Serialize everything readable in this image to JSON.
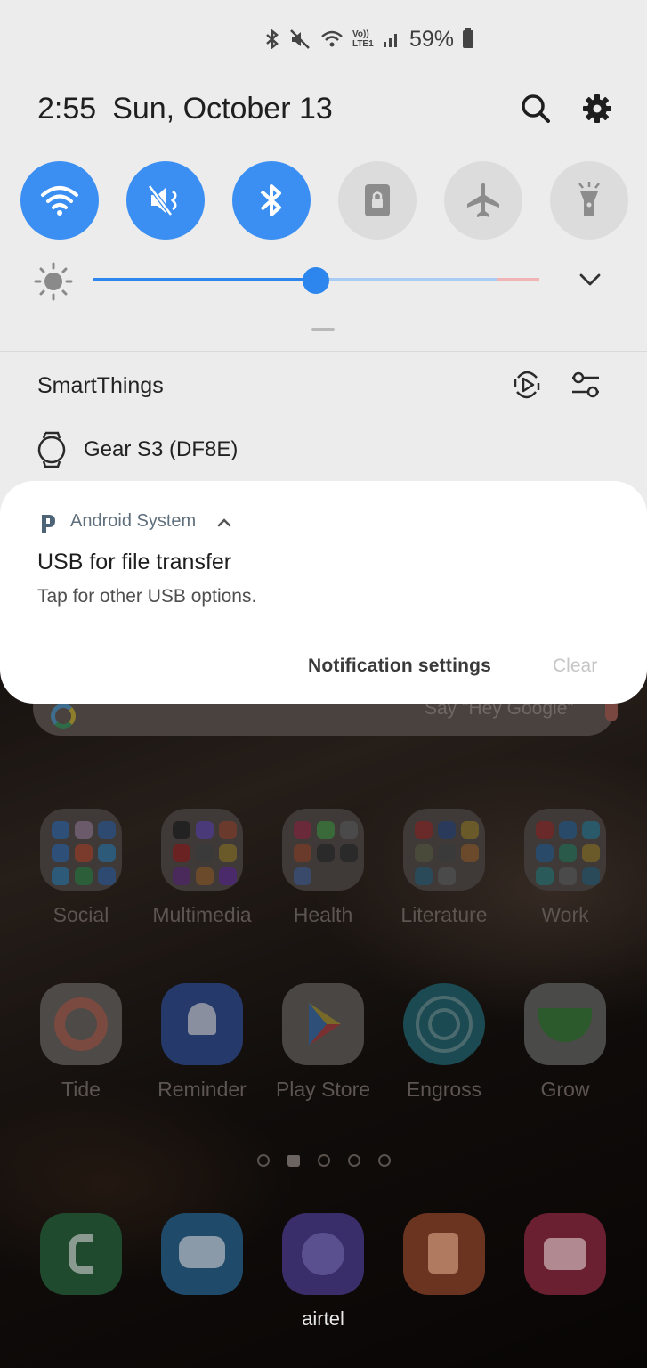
{
  "status_bar": {
    "battery_text": "59%",
    "network_label": "Vo)) LTE1"
  },
  "header": {
    "time": "2:55",
    "date": "Sun, October 13"
  },
  "quick_toggles": [
    {
      "name": "wifi",
      "state": "on"
    },
    {
      "name": "mute",
      "state": "on"
    },
    {
      "name": "bluetooth",
      "state": "on"
    },
    {
      "name": "portrait-lock",
      "state": "off"
    },
    {
      "name": "airplane-mode",
      "state": "off"
    },
    {
      "name": "flashlight",
      "state": "off"
    }
  ],
  "brightness": {
    "level_fraction": 0.5
  },
  "smartthings": {
    "title": "SmartThings",
    "device": "Gear S3 (DF8E)"
  },
  "notification": {
    "app_name": "Android System",
    "title": "USB for file transfer",
    "body": "Tap for other USB options.",
    "settings_label": "Notification settings",
    "clear_label": "Clear"
  },
  "home": {
    "search_hint": "Say \"Hey Google\"",
    "row1": [
      "Social",
      "Multimedia",
      "Health",
      "Literature",
      "Work"
    ],
    "row2": [
      "Tide",
      "Reminder",
      "Play Store",
      "Engross",
      "Grow"
    ],
    "dock_label": "airtel"
  },
  "colors": {
    "accent": "#3b8ff2",
    "shade_bg": "#ececec",
    "card_bg": "#ffffff"
  }
}
